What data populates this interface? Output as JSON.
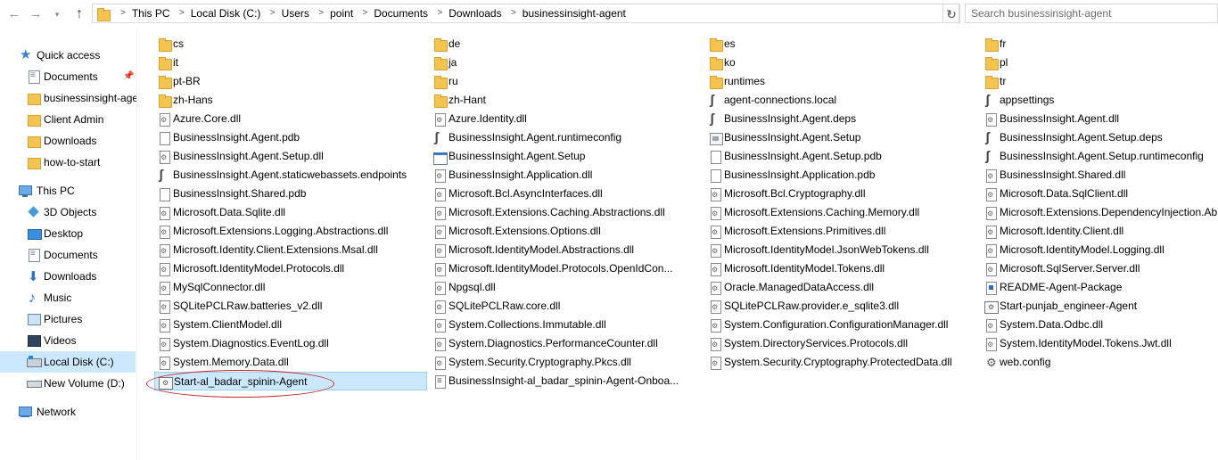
{
  "toolbar": {
    "back_icon": "back-arrow-icon",
    "forward_icon": "forward-arrow-icon",
    "recent_icon": "chevron-down-icon",
    "up_icon": "up-arrow-icon"
  },
  "address": {
    "crumbs": [
      "This PC",
      "Local Disk (C:)",
      "Users",
      "point",
      "Documents",
      "Downloads",
      "businessinsight-agent"
    ]
  },
  "search": {
    "placeholder": "Search businessinsight-agent"
  },
  "nav": {
    "quick_access": "Quick access",
    "quick_items": [
      "Documents",
      "businessinsight-age",
      "Client Admin",
      "Downloads",
      "how-to-start"
    ],
    "this_pc": "This PC",
    "pc_items": [
      "3D Objects",
      "Desktop",
      "Documents",
      "Downloads",
      "Music",
      "Pictures",
      "Videos",
      "Local Disk (C:)",
      "New Volume (D:)"
    ],
    "network": "Network",
    "selected": "Local Disk (C:)"
  },
  "files": {
    "columns": [
      [
        {
          "name": "cs",
          "icon": "folder"
        },
        {
          "name": "it",
          "icon": "folder"
        },
        {
          "name": "pt-BR",
          "icon": "folder"
        },
        {
          "name": "zh-Hans",
          "icon": "folder"
        },
        {
          "name": "Azure.Core.dll",
          "icon": "dll"
        },
        {
          "name": "BusinessInsight.Agent.pdb",
          "icon": "file"
        },
        {
          "name": "BusinessInsight.Agent.Setup.dll",
          "icon": "dll"
        },
        {
          "name": "BusinessInsight.Agent.staticwebassets.endpoints",
          "icon": "json"
        },
        {
          "name": "BusinessInsight.Shared.pdb",
          "icon": "file"
        },
        {
          "name": "Microsoft.Data.Sqlite.dll",
          "icon": "dll"
        },
        {
          "name": "Microsoft.Extensions.Logging.Abstractions.dll",
          "icon": "dll"
        },
        {
          "name": "Microsoft.Identity.Client.Extensions.Msal.dll",
          "icon": "dll"
        },
        {
          "name": "Microsoft.IdentityModel.Protocols.dll",
          "icon": "dll"
        },
        {
          "name": "MySqlConnector.dll",
          "icon": "dll"
        },
        {
          "name": "SQLitePCLRaw.batteries_v2.dll",
          "icon": "dll"
        },
        {
          "name": "System.ClientModel.dll",
          "icon": "dll"
        },
        {
          "name": "System.Diagnostics.EventLog.dll",
          "icon": "dll"
        },
        {
          "name": "System.Memory.Data.dll",
          "icon": "dll"
        },
        {
          "name": "Start-al_badar_spinin-Agent",
          "icon": "bat",
          "selected": true
        }
      ],
      [
        {
          "name": "de",
          "icon": "folder"
        },
        {
          "name": "ja",
          "icon": "folder"
        },
        {
          "name": "ru",
          "icon": "folder"
        },
        {
          "name": "zh-Hant",
          "icon": "folder"
        },
        {
          "name": "Azure.Identity.dll",
          "icon": "dll"
        },
        {
          "name": "BusinessInsight.Agent.runtimeconfig",
          "icon": "json"
        },
        {
          "name": "BusinessInsight.Agent.Setup",
          "icon": "exe"
        },
        {
          "name": "BusinessInsight.Application.dll",
          "icon": "dll"
        },
        {
          "name": "Microsoft.Bcl.AsyncInterfaces.dll",
          "icon": "dll"
        },
        {
          "name": "Microsoft.Extensions.Caching.Abstractions.dll",
          "icon": "dll"
        },
        {
          "name": "Microsoft.Extensions.Options.dll",
          "icon": "dll"
        },
        {
          "name": "Microsoft.IdentityModel.Abstractions.dll",
          "icon": "dll"
        },
        {
          "name": "Microsoft.IdentityModel.Protocols.OpenIdCon...",
          "icon": "dll"
        },
        {
          "name": "Npgsql.dll",
          "icon": "dll"
        },
        {
          "name": "SQLitePCLRaw.core.dll",
          "icon": "dll"
        },
        {
          "name": "System.Collections.Immutable.dll",
          "icon": "dll"
        },
        {
          "name": "System.Diagnostics.PerformanceCounter.dll",
          "icon": "dll"
        },
        {
          "name": "System.Security.Cryptography.Pkcs.dll",
          "icon": "dll"
        },
        {
          "name": "BusinessInsight-al_badar_spinin-Agent-Onboa...",
          "icon": "txt"
        }
      ],
      [
        {
          "name": "es",
          "icon": "folder"
        },
        {
          "name": "ko",
          "icon": "folder"
        },
        {
          "name": "runtimes",
          "icon": "folder"
        },
        {
          "name": "agent-connections.local",
          "icon": "json"
        },
        {
          "name": "BusinessInsight.Agent.deps",
          "icon": "json"
        },
        {
          "name": "BusinessInsight.Agent.Setup",
          "icon": "app"
        },
        {
          "name": "BusinessInsight.Agent.Setup.pdb",
          "icon": "file"
        },
        {
          "name": "BusinessInsight.Application.pdb",
          "icon": "file"
        },
        {
          "name": "Microsoft.Bcl.Cryptography.dll",
          "icon": "dll"
        },
        {
          "name": "Microsoft.Extensions.Caching.Memory.dll",
          "icon": "dll"
        },
        {
          "name": "Microsoft.Extensions.Primitives.dll",
          "icon": "dll"
        },
        {
          "name": "Microsoft.IdentityModel.JsonWebTokens.dll",
          "icon": "dll"
        },
        {
          "name": "Microsoft.IdentityModel.Tokens.dll",
          "icon": "dll"
        },
        {
          "name": "Oracle.ManagedDataAccess.dll",
          "icon": "dll"
        },
        {
          "name": "SQLitePCLRaw.provider.e_sqlite3.dll",
          "icon": "dll"
        },
        {
          "name": "System.Configuration.ConfigurationManager.dll",
          "icon": "dll"
        },
        {
          "name": "System.DirectoryServices.Protocols.dll",
          "icon": "dll"
        },
        {
          "name": "System.Security.Cryptography.ProtectedData.dll",
          "icon": "dll"
        }
      ],
      [
        {
          "name": "fr",
          "icon": "folder"
        },
        {
          "name": "pl",
          "icon": "folder"
        },
        {
          "name": "tr",
          "icon": "folder"
        },
        {
          "name": "appsettings",
          "icon": "json"
        },
        {
          "name": "BusinessInsight.Agent.dll",
          "icon": "dll"
        },
        {
          "name": "BusinessInsight.Agent.Setup.deps",
          "icon": "json"
        },
        {
          "name": "BusinessInsight.Agent.Setup.runtimeconfig",
          "icon": "json"
        },
        {
          "name": "BusinessInsight.Shared.dll",
          "icon": "dll"
        },
        {
          "name": "Microsoft.Data.SqlClient.dll",
          "icon": "dll"
        },
        {
          "name": "Microsoft.Extensions.DependencyInjection.Ab...",
          "icon": "dll"
        },
        {
          "name": "Microsoft.Identity.Client.dll",
          "icon": "dll"
        },
        {
          "name": "Microsoft.IdentityModel.Logging.dll",
          "icon": "dll"
        },
        {
          "name": "Microsoft.SqlServer.Server.dll",
          "icon": "dll"
        },
        {
          "name": "README-Agent-Package",
          "icon": "readme"
        },
        {
          "name": "Start-punjab_engineer-Agent",
          "icon": "bat"
        },
        {
          "name": "System.Data.Odbc.dll",
          "icon": "dll"
        },
        {
          "name": "System.IdentityModel.Tokens.Jwt.dll",
          "icon": "dll"
        },
        {
          "name": "web.config",
          "icon": "cfg"
        }
      ]
    ]
  },
  "annotation": {
    "color": "#c62828"
  }
}
